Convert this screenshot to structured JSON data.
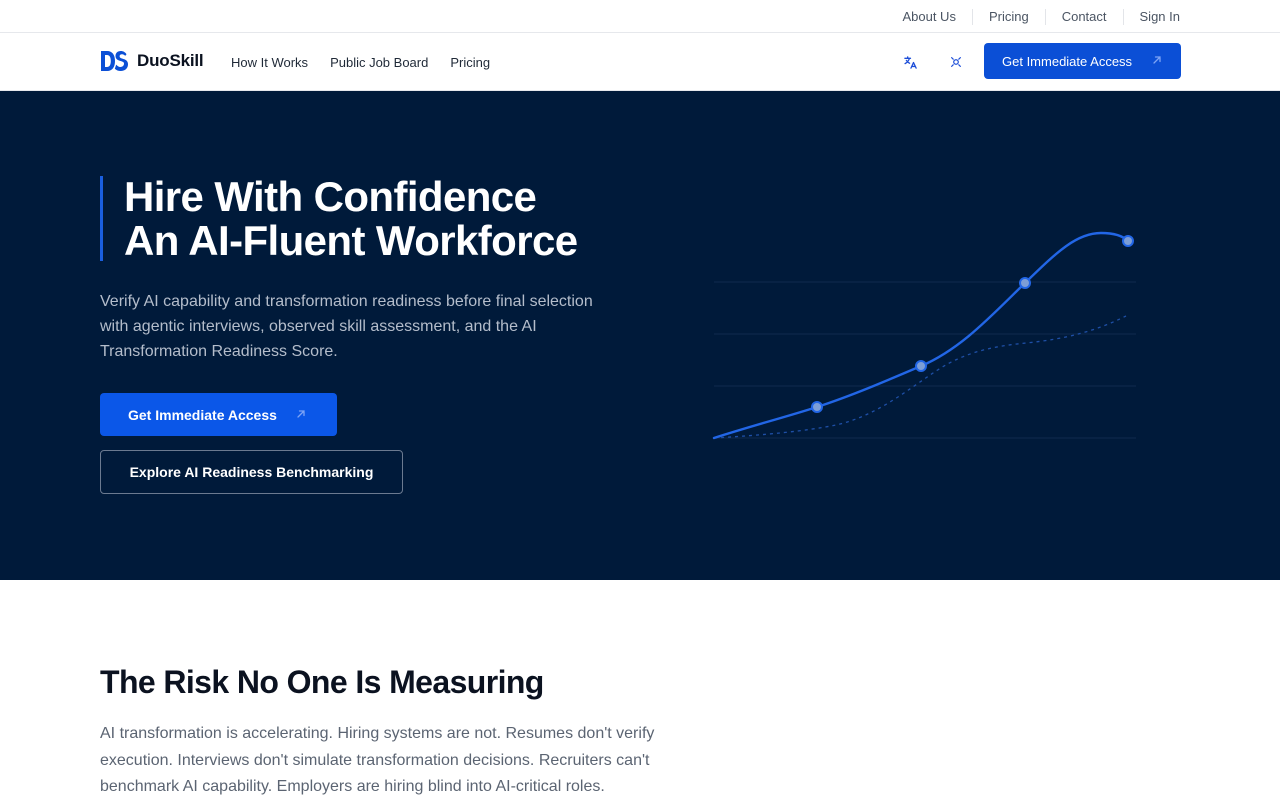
{
  "utility_nav": {
    "links": [
      "About Us",
      "Pricing",
      "Contact",
      "Sign In"
    ]
  },
  "header": {
    "logo_text": "DuoSkill",
    "logo_icon": "ds-logo-mark",
    "nav_links": [
      "How It Works",
      "Public Job Board",
      "Pricing"
    ],
    "icons": [
      "translate-icon",
      "theme-toggle-icon"
    ],
    "cta_label": "Get Immediate Access",
    "cta_icon": "arrow-up-right-icon"
  },
  "hero": {
    "title_line1": "Hire With Confidence",
    "title_line2": "An AI-Fluent Workforce",
    "subtitle": "Verify AI capability and transformation readiness before final selection with agentic interviews, observed skill assessment, and the AI Transformation Readiness Score.",
    "primary_cta": "Get Immediate Access",
    "secondary_cta": "Explore AI Readiness Benchmarking",
    "graph_icon": "growth-curve-illustration"
  },
  "risk": {
    "title": "The Risk No One Is Measuring",
    "body": "AI transformation is accelerating. Hiring systems are not. Resumes don't verify execution. Interviews don't simulate transformation decisions. Recruiters can't benchmark AI capability. Employers are hiring blind into AI-critical roles."
  },
  "colors": {
    "brand_blue": "#0b4fd6",
    "hero_bg": "#001a3a",
    "accent": "#1a5fe0"
  }
}
